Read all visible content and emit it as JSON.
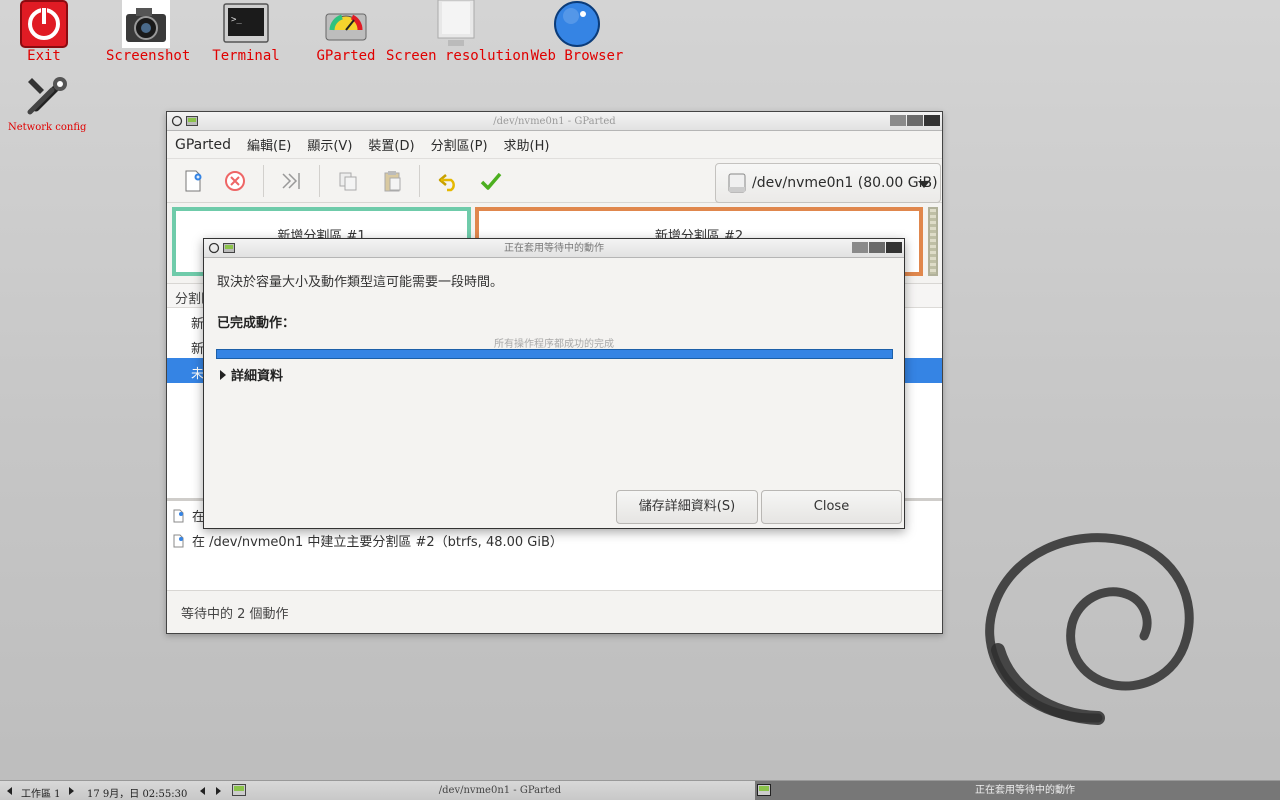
{
  "desktop": {
    "icons": [
      {
        "label": "Exit"
      },
      {
        "label": "Screenshot"
      },
      {
        "label": "Terminal"
      },
      {
        "label": "GParted"
      },
      {
        "label": "Screen resolution"
      },
      {
        "label": "Web Browser"
      },
      {
        "label": "Network config"
      }
    ]
  },
  "main_window": {
    "title": "/dev/nvme0n1 - GParted",
    "menu": [
      "GParted",
      "編輯(E)",
      "顯示(V)",
      "裝置(D)",
      "分割區(P)",
      "求助(H)"
    ],
    "device": "/dev/nvme0n1 (80.00 GiB)",
    "partitions": [
      "新增分割區 #1",
      "新增分割區 #2"
    ],
    "table_header": "分割區",
    "rows": [
      "新",
      "新",
      "未"
    ],
    "operations": [
      {
        "text": "在"
      },
      {
        "text": "在 /dev/nvme0n1 中建立主要分割區 #2（btrfs, 48.00 GiB）"
      }
    ],
    "status": "等待中的 2 個動作"
  },
  "dialog": {
    "title": "正在套用等待中的動作",
    "info": "取決於容量大小及動作類型這可能需要一段時間。",
    "completed_label": "已完成動作：",
    "progress_text": "所有操作程序都成功的完成",
    "progress": 1.0,
    "details_label": "詳細資料",
    "save_button": "儲存詳細資料(S)",
    "close_button": "Close"
  },
  "taskbar": {
    "workspace": "工作區 1",
    "clock": "17 9月，日 02:55:30",
    "task_main": "/dev/nvme0n1 - GParted",
    "task_dialog": "正在套用等待中的動作"
  },
  "colors": {
    "accent": "#3584e4",
    "partition1_border": "#6fcbaa",
    "partition2_border": "#e0874d",
    "icon_label": "#e00000"
  }
}
